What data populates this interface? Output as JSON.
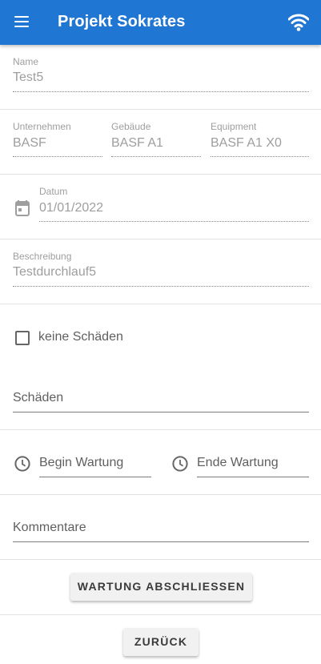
{
  "app_bar": {
    "title": "Projekt Sokrates",
    "color": "#1f76d3"
  },
  "fields": {
    "name": {
      "label": "Name",
      "value": "Test5"
    },
    "unternehmen": {
      "label": "Unternehmen",
      "value": "BASF"
    },
    "gebaeude": {
      "label": "Gebäude",
      "value": "BASF A1"
    },
    "equipment": {
      "label": "Equipment",
      "value": "BASF A1 X0"
    },
    "datum": {
      "label": "Datum",
      "value": "01/01/2022"
    },
    "beschreibung": {
      "label": "Beschreibung",
      "value": "Testdurchlauf5"
    }
  },
  "checkbox": {
    "label": "keine Schäden",
    "checked": false
  },
  "inputs": {
    "schaeden": {
      "placeholder": "Schäden"
    },
    "begin_wartung": {
      "placeholder": "Begin Wartung"
    },
    "ende_wartung": {
      "placeholder": "Ende Wartung"
    },
    "kommentare": {
      "placeholder": "Kommentare"
    }
  },
  "buttons": {
    "wartung_abschliessen": "WARTUNG ABSCHLIESSEN",
    "zurueck": "ZURÜCK"
  },
  "icons": [
    "menu-icon",
    "wifi-icon",
    "calendar-icon",
    "clock-icon"
  ]
}
